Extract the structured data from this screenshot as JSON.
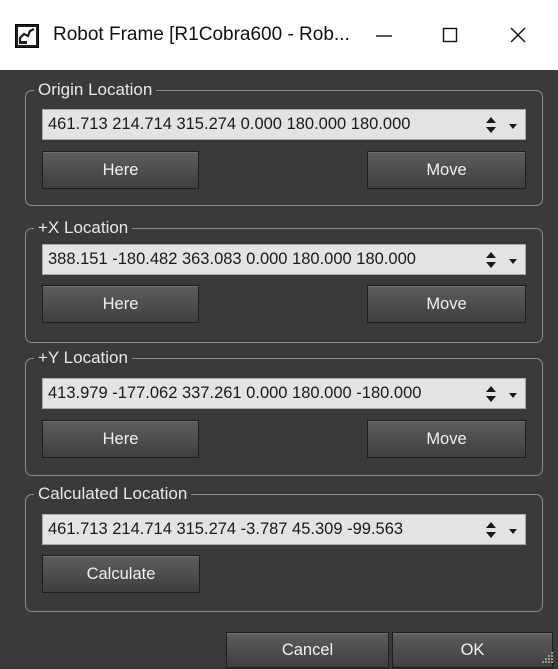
{
  "window": {
    "title": "Robot Frame [R1Cobra600 - Rob...",
    "icons": [
      "app-icon",
      "minimize-icon",
      "maximize-icon",
      "close-icon"
    ]
  },
  "origin": {
    "label": "Origin Location",
    "value": "461.713 214.714 315.274 0.000 180.000 180.000",
    "here": "Here",
    "move": "Move"
  },
  "plus_x": {
    "label": "+X Location",
    "value": "388.151 -180.482 363.083 0.000 180.000 180.000",
    "here": "Here",
    "move": "Move"
  },
  "plus_y": {
    "label": "+Y Location",
    "value": "413.979 -177.062 337.261 0.000 180.000 -180.000",
    "here": "Here",
    "move": "Move"
  },
  "calculated": {
    "label": "Calculated Location",
    "value": "461.713 214.714 315.274 -3.787 45.309 -99.563",
    "calculate": "Calculate"
  },
  "footer": {
    "cancel": "Cancel",
    "ok": "OK"
  }
}
